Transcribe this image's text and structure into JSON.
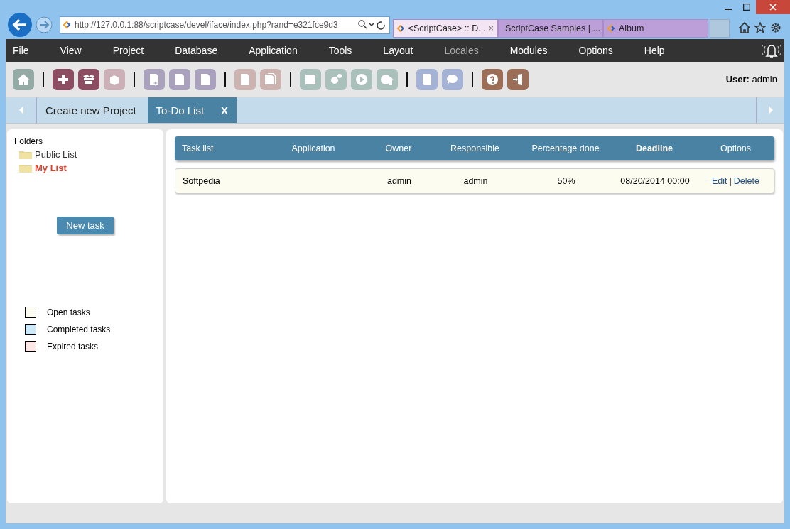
{
  "browser": {
    "address": "http://127.0.0.1:88/scriptcase/devel/iface/index.php?rand=e321fce9d3",
    "tabs": [
      {
        "label": "<ScriptCase> :: D...",
        "selected": true,
        "close": "×"
      },
      {
        "label": "ScriptCase Samples | ...",
        "selected": false
      },
      {
        "label": "Album",
        "selected": false
      }
    ]
  },
  "menu": [
    {
      "label": "File",
      "disabled": false
    },
    {
      "label": "View",
      "disabled": false
    },
    {
      "label": "Project",
      "disabled": false
    },
    {
      "label": "Database",
      "disabled": false
    },
    {
      "label": "Application",
      "disabled": false
    },
    {
      "label": "Tools",
      "disabled": false
    },
    {
      "label": "Layout",
      "disabled": false
    },
    {
      "label": "Locales",
      "disabled": true
    },
    {
      "label": "Modules",
      "disabled": false
    },
    {
      "label": "Options",
      "disabled": false
    },
    {
      "label": "Help",
      "disabled": false
    }
  ],
  "user": {
    "label": "User:",
    "name": "admin"
  },
  "tabs": [
    {
      "label": "Create new Project",
      "selected": false
    },
    {
      "label": "To-Do List",
      "selected": true,
      "close": "X"
    }
  ],
  "folders": {
    "title": "Folders",
    "items": [
      {
        "label": "Public List",
        "selected": false
      },
      {
        "label": "My List",
        "selected": true
      }
    ]
  },
  "new_task_button": "New task",
  "legend": [
    {
      "label": "Open tasks",
      "color": "#fcfdf0"
    },
    {
      "label": "Completed tasks",
      "color": "#cbe9f9"
    },
    {
      "label": "Expired tasks",
      "color": "#fde6e6"
    }
  ],
  "table": {
    "columns": [
      {
        "label": "Task list",
        "bold": false
      },
      {
        "label": "Application",
        "bold": false
      },
      {
        "label": "Owner",
        "bold": false
      },
      {
        "label": "Responsible",
        "bold": false
      },
      {
        "label": "Percentage done",
        "bold": false
      },
      {
        "label": "Deadline",
        "bold": true
      },
      {
        "label": "Options",
        "bold": false
      }
    ],
    "rows": [
      {
        "cells": [
          "Softpedia",
          "",
          "admin",
          "admin",
          "50%",
          "08/20/2014 00:00"
        ],
        "edit": "Edit",
        "separator": "|",
        "delete": "Delete"
      }
    ]
  }
}
